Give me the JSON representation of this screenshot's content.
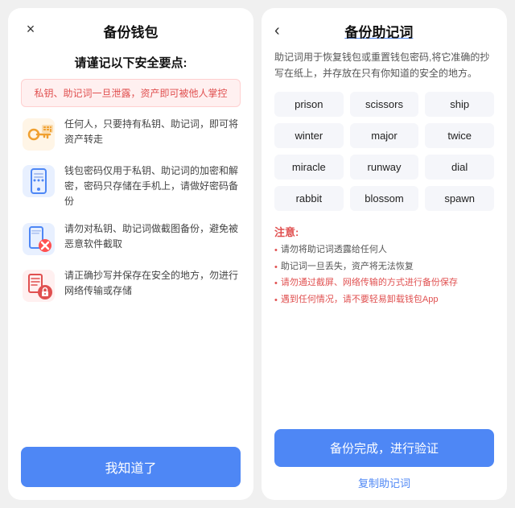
{
  "left": {
    "title": "备份钱包",
    "close_icon": "×",
    "security_title": "请谨记以下安全要点:",
    "warning_text": "私钥、助记词一旦泄露，资产即可被他人掌控",
    "security_items": [
      {
        "id": "key",
        "text": "任何人，只要持有私钥、助记词，即可将资产转走"
      },
      {
        "id": "phone",
        "text": "钱包密码仅用于私钥、助记词的加密和解密，密码只存储在手机上，请做好密码备份"
      },
      {
        "id": "screenshot",
        "text": "请勿对私钥、助记词做截图备份，避免被恶意软件截取"
      },
      {
        "id": "location",
        "text": "请正确抄写并保存在安全的地方，勿进行网络传输或存储"
      }
    ],
    "confirm_label": "我知道了"
  },
  "right": {
    "title": "备份助记词",
    "back_icon": "‹",
    "description": "助记词用于恢复钱包或重置钱包密码,将它准确的抄写在纸上，并存放在只有你知道的安全的地方。",
    "mnemonic_words": [
      "prison",
      "scissors",
      "ship",
      "winter",
      "major",
      "twice",
      "miracle",
      "runway",
      "dial",
      "rabbit",
      "blossom",
      "spawn"
    ],
    "notes_title": "注意:",
    "notes": [
      {
        "text": "请勿将助记词透露给任何人",
        "red": false
      },
      {
        "text": "助记词一旦丢失，资产将无法恢复",
        "red": false
      },
      {
        "text": "请勿通过截屏、网络传输的方式进行备份保存",
        "red": true
      },
      {
        "text": "遇到任何情况，请不要轻易卸载钱包App",
        "red": true
      }
    ],
    "backup_done_label": "备份完成，进行验证",
    "copy_label": "复制助记词"
  }
}
